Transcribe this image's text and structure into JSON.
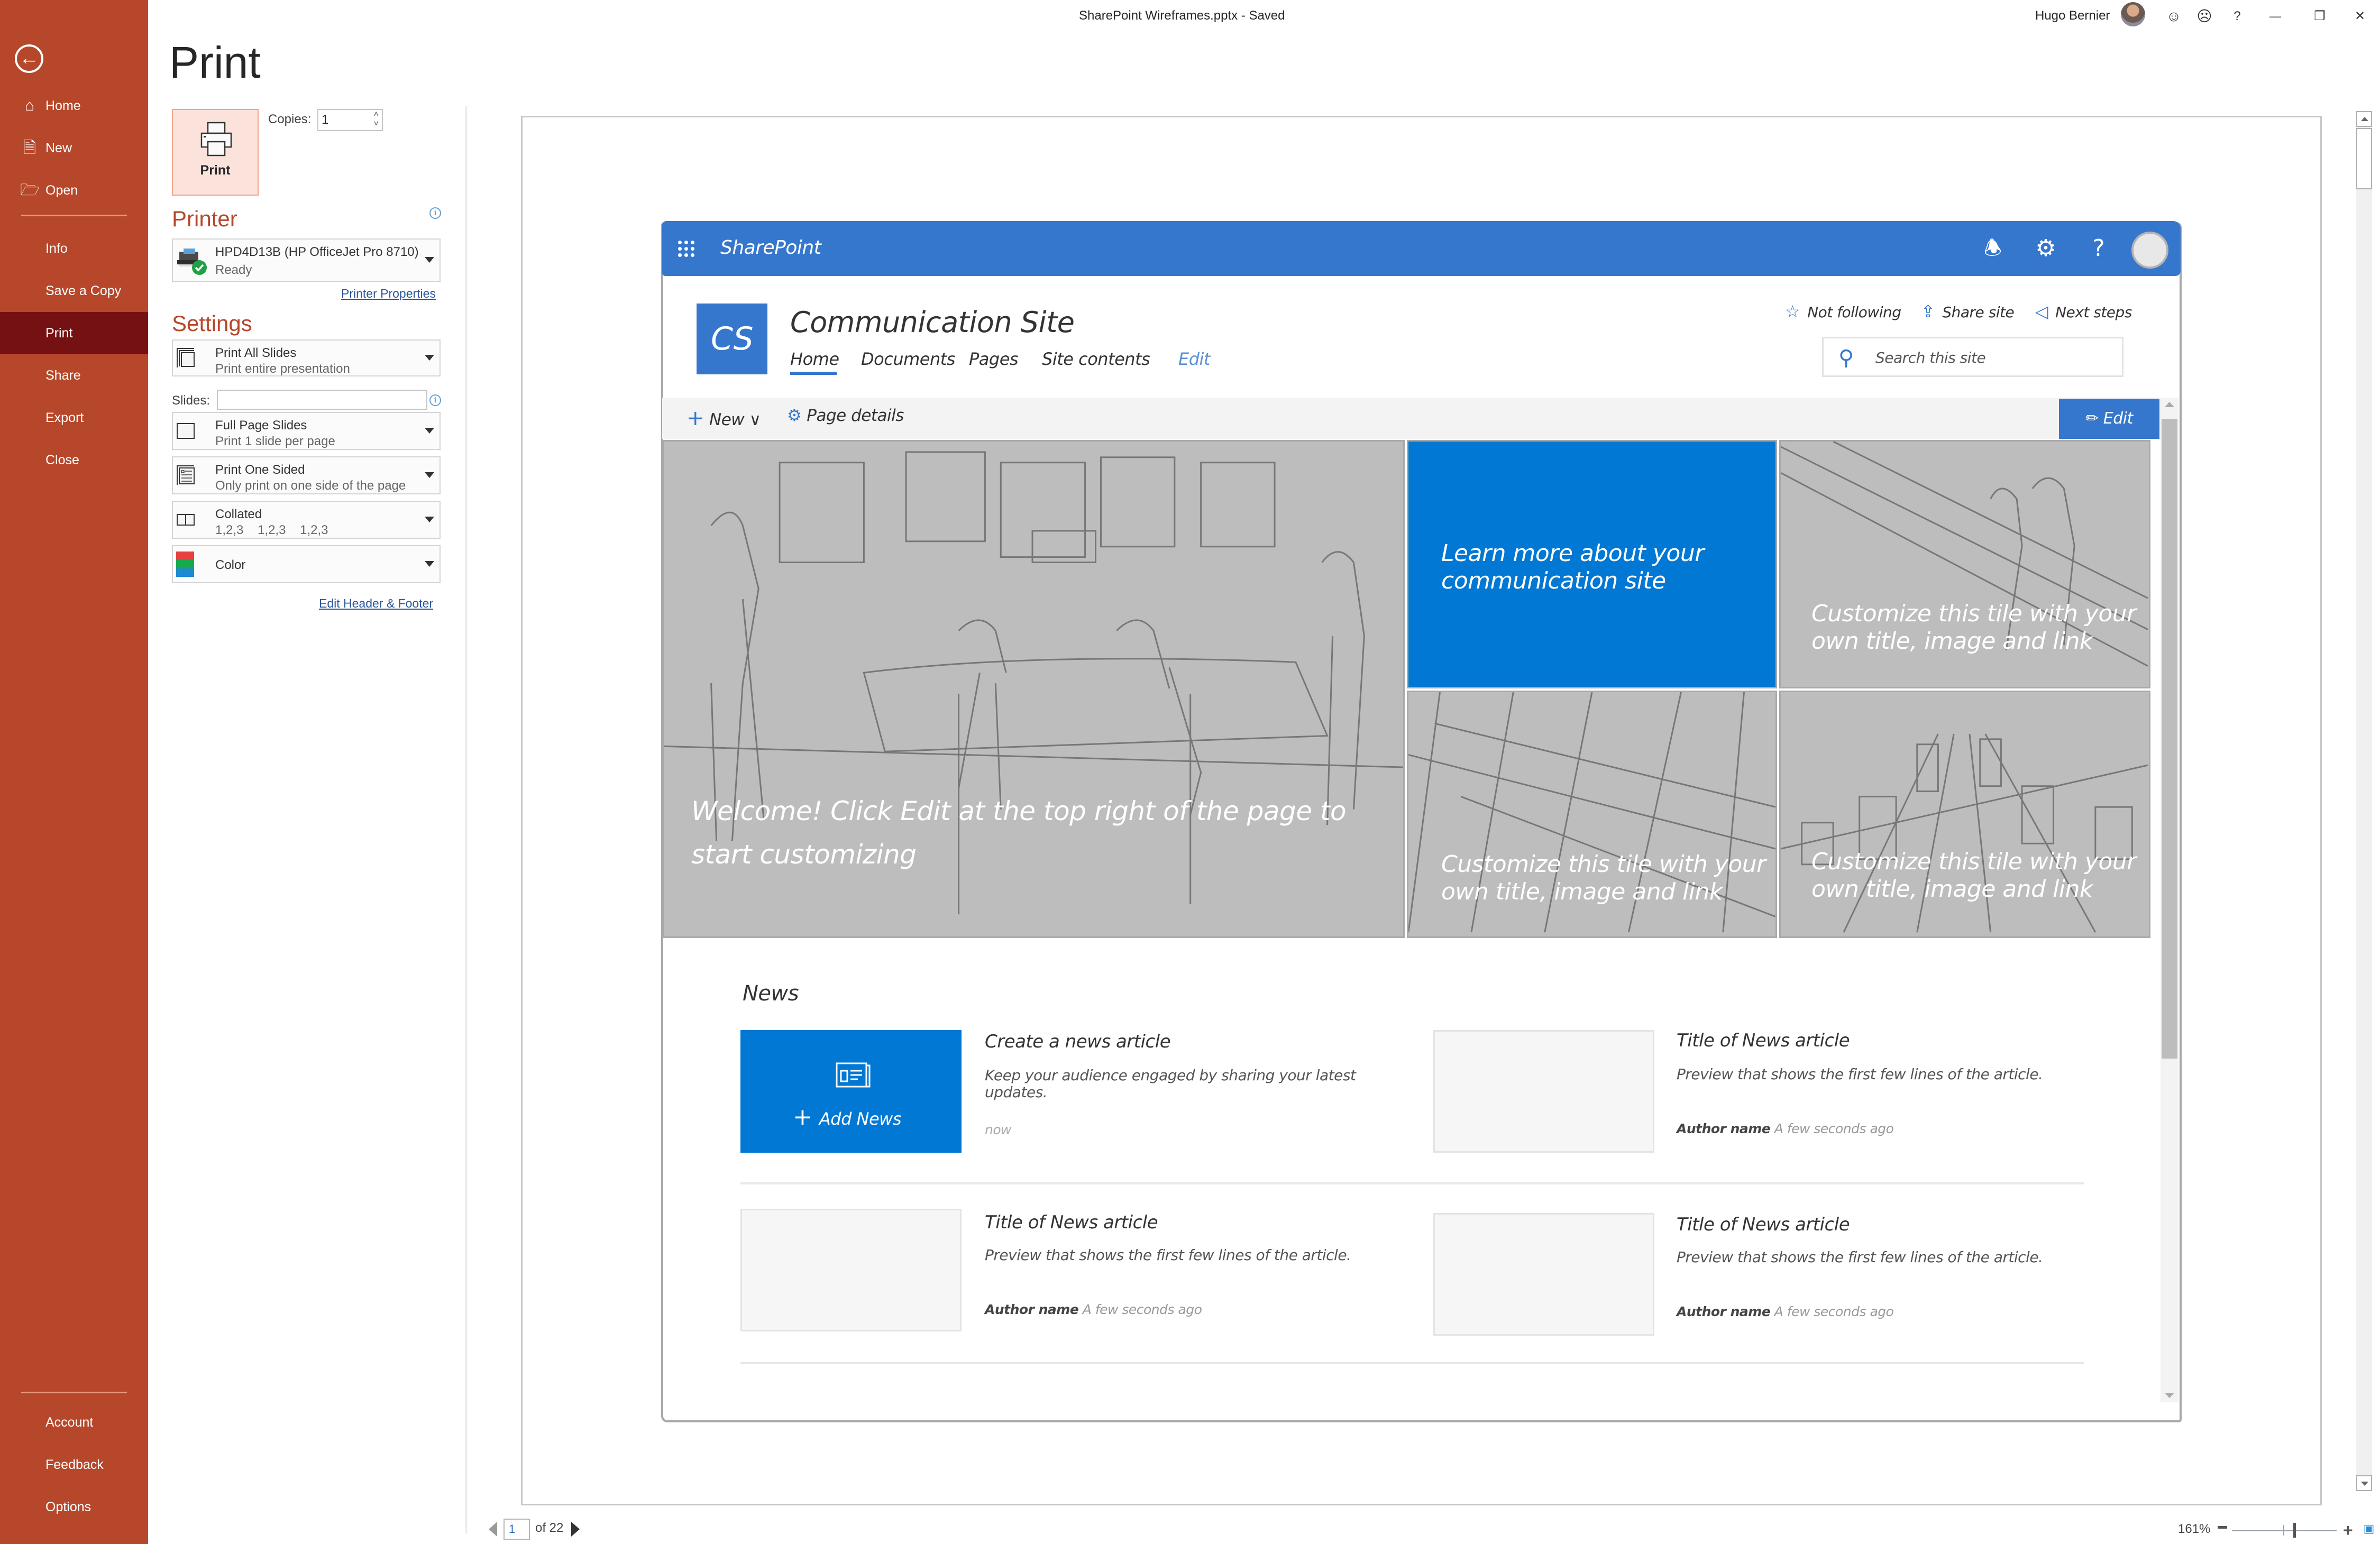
{
  "window": {
    "title": "SharePoint Wireframes.pptx  -  Saved",
    "user_name": "Hugo Bernier",
    "buttons": {
      "smile": "☺",
      "frown": "☹",
      "help": "?",
      "minimize": "—",
      "restore": "❐",
      "close": "✕"
    }
  },
  "nav": {
    "back_icon": "arrow-left-icon",
    "items": [
      {
        "label": "Home",
        "icon": "home-icon"
      },
      {
        "label": "New",
        "icon": "new-document-icon"
      },
      {
        "label": "Open",
        "icon": "folder-open-icon"
      },
      {
        "label": "Info"
      },
      {
        "label": "Save a Copy"
      },
      {
        "label": "Print",
        "active": true
      },
      {
        "label": "Share"
      },
      {
        "label": "Export"
      },
      {
        "label": "Close"
      }
    ],
    "bottom_items": [
      {
        "label": "Account"
      },
      {
        "label": "Feedback"
      },
      {
        "label": "Options"
      }
    ],
    "colors": {
      "background": "#b7472a",
      "active": "#751013"
    }
  },
  "print": {
    "heading": "Print",
    "print_button_label": "Print",
    "copies_label": "Copies:",
    "copies_value": "1",
    "printer_heading": "Printer",
    "printer_name": "HPD4D13B (HP OfficeJet Pro 8710)",
    "printer_status": "Ready",
    "printer_properties_link": "Printer Properties",
    "settings_heading": "Settings",
    "settings": [
      {
        "title": "Print All Slides",
        "subtitle": "Print entire presentation"
      },
      {
        "title": "Full Page Slides",
        "subtitle": "Print 1 slide per page"
      },
      {
        "title": "Print One Sided",
        "subtitle": "Only print on one side of the page"
      },
      {
        "title": "Collated",
        "subtitle": "1,2,3    1,2,3    1,2,3"
      },
      {
        "title": "Color",
        "subtitle": ""
      }
    ],
    "slides_label": "Slides:",
    "slides_value": "",
    "edit_header_footer_link": "Edit Header & Footer"
  },
  "preview": {
    "page_current": "1",
    "page_total_label": "of 22",
    "zoom_label": "161%",
    "zoom_percent": 161
  },
  "wireframe": {
    "brand": "SharePoint",
    "suite_icons": [
      "bell-icon",
      "gear-icon",
      "help-icon"
    ],
    "site_logo": "CS",
    "site_title": "Communication Site",
    "site_nav": [
      "Home",
      "Documents",
      "Pages",
      "Site contents"
    ],
    "site_nav_edit": "Edit",
    "actions": [
      {
        "label": "Not following",
        "icon": "☆"
      },
      {
        "label": "Share site",
        "icon": "⇪"
      },
      {
        "label": "Next steps",
        "icon": "◁"
      }
    ],
    "search_placeholder": "Search this site",
    "command_bar": {
      "new_label": "New",
      "page_details_label": "Page details",
      "edit_label": "Edit"
    },
    "hero": {
      "main": "Welcome! Click Edit at the top right of the page to start customizing",
      "learn_more": "Learn more about your communication site",
      "tile_text": "Customize this tile with your own title, image and link"
    },
    "news": {
      "heading": "News",
      "add_news_label": "Add News",
      "create": {
        "title": "Create a news article",
        "desc": "Keep your audience engaged by sharing your latest updates.",
        "time": "now"
      },
      "articles": [
        {
          "title": "Title of News article",
          "preview": "Preview that shows the first few lines of the article.",
          "author": "Author name",
          "time": "A few seconds ago"
        },
        {
          "title": "Title of News article",
          "preview": "Preview that shows the first few lines of the article.",
          "author": "Author name",
          "time": "A few seconds ago"
        },
        {
          "title": "Title of News article",
          "preview": "Preview that shows the first few lines of the article.",
          "author": "Author name",
          "time": "A few seconds ago"
        }
      ]
    },
    "colors": {
      "brand_blue": "#3577cd",
      "tile_blue": "#0078d4",
      "tile_gray": "#bdbdbd"
    }
  }
}
